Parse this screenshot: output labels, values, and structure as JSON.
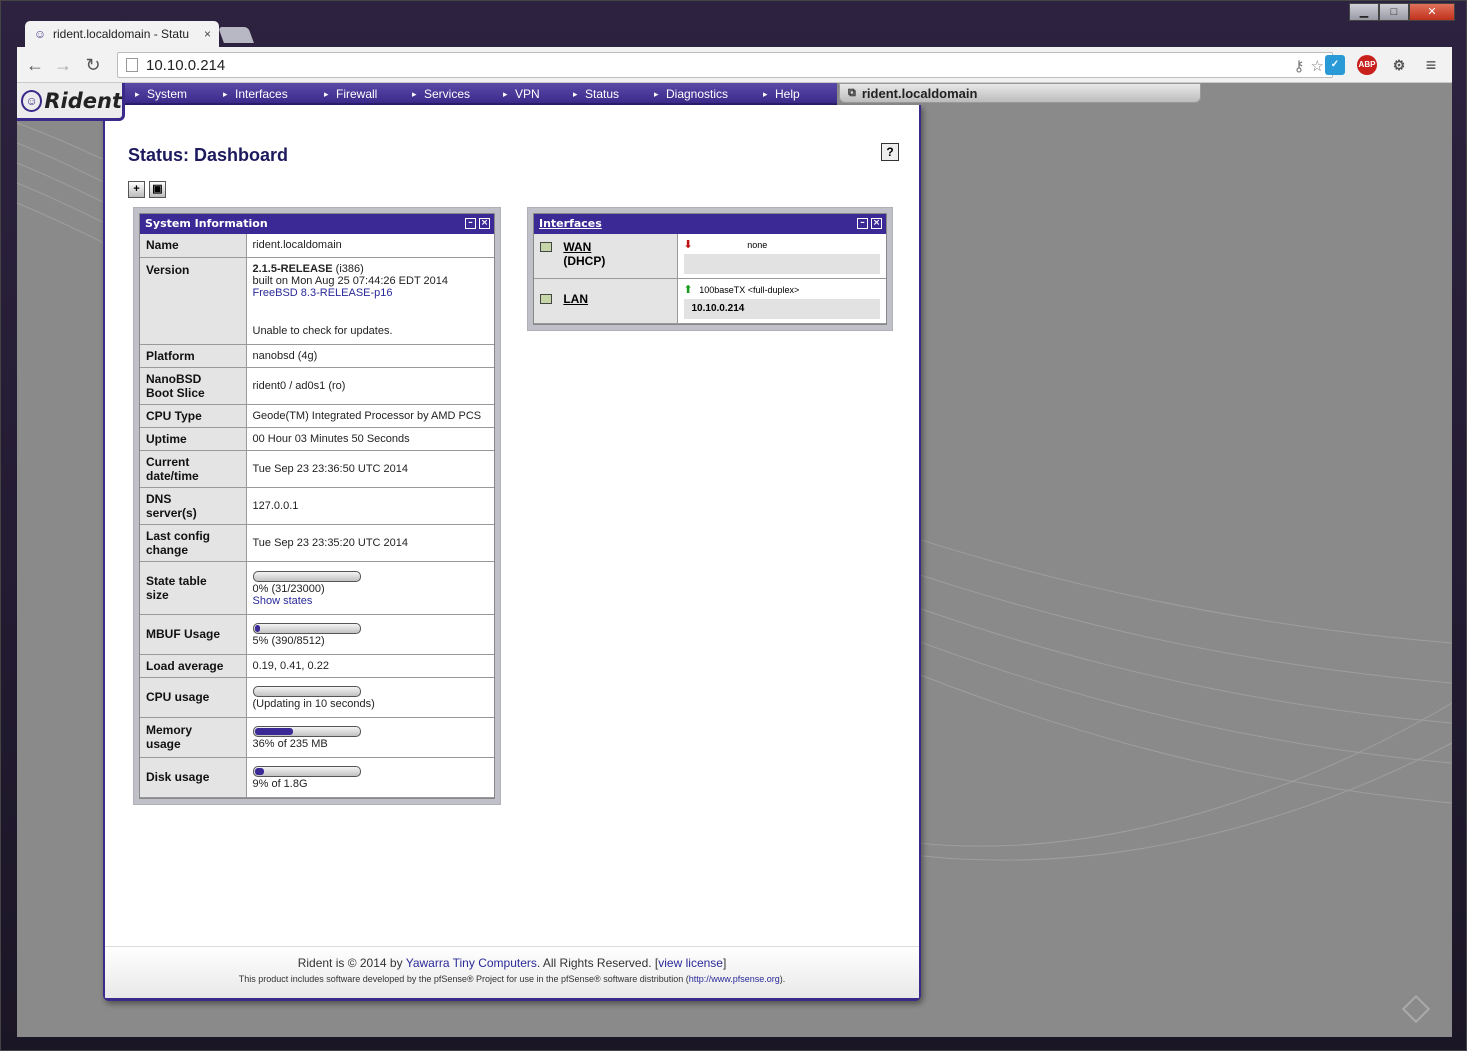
{
  "browser": {
    "tab_title": "rident.localdomain - Statu",
    "tab_close": "×",
    "url": "10.10.0.214",
    "back": "←",
    "forward": "→",
    "reload": "↻",
    "menu": "≡",
    "window_min": "▁",
    "window_max": "□",
    "window_close": "✕",
    "ext_abp": "ABP"
  },
  "nav": {
    "logo": "Rident",
    "items": [
      "System",
      "Interfaces",
      "Firewall",
      "Services",
      "VPN",
      "Status",
      "Diagnostics",
      "Help"
    ],
    "hostname": "rident.localdomain"
  },
  "page": {
    "title": "Status: Dashboard",
    "help": "?"
  },
  "system_info": {
    "title": "System Information",
    "name_label": "Name",
    "name": "rident.localdomain",
    "version_label": "Version",
    "version_release": "2.1.5-RELEASE",
    "version_arch": "(i386)",
    "version_built": "built on Mon Aug 25 07:44:26 EDT 2014",
    "version_freebsd": "FreeBSD 8.3-RELEASE-p16",
    "version_update": "Unable to check for updates.",
    "platform_label": "Platform",
    "platform": "nanobsd (4g)",
    "bootslice_label_1": "NanoBSD",
    "bootslice_label_2": "Boot Slice",
    "bootslice": "rident0 / ad0s1 (ro)",
    "cpu_type_label": "CPU Type",
    "cpu_type": "Geode(TM) Integrated Processor by AMD PCS",
    "uptime_label": "Uptime",
    "uptime": "00 Hour 03 Minutes 50 Seconds",
    "datetime_label_1": "Current",
    "datetime_label_2": "date/time",
    "datetime": "Tue Sep 23 23:36:50 UTC 2014",
    "dns_label_1": "DNS",
    "dns_label_2": "server(s)",
    "dns": "127.0.0.1",
    "lastconfig_label_1": "Last config",
    "lastconfig_label_2": "change",
    "lastconfig": "Tue Sep 23 23:35:20 UTC 2014",
    "state_label_1": "State table",
    "state_label_2": "size",
    "state_value": "0% (31/23000)",
    "state_fraction": 0.0,
    "show_states": "Show states",
    "mbuf_label": "MBUF Usage",
    "mbuf_value": "5% (390/8512)",
    "mbuf_fraction": 0.05,
    "load_label": "Load average",
    "load": "0.19, 0.41, 0.22",
    "cpu_label": "CPU usage",
    "cpu_value": "(Updating in 10 seconds)",
    "cpu_fraction": 0.0,
    "mem_label_1": "Memory",
    "mem_label_2": "usage",
    "mem_value": "36% of 235 MB",
    "mem_fraction": 0.36,
    "disk_label": "Disk usage",
    "disk_value": "9% of 1.8G",
    "disk_fraction": 0.09
  },
  "interfaces": {
    "title": "Interfaces",
    "wan_name": "WAN",
    "wan_type": "(DHCP)",
    "wan_arrow": "⬇",
    "wan_media": "none",
    "wan_ip": "",
    "lan_name": "LAN",
    "lan_arrow": "⬆",
    "lan_media": "100baseTX <full-duplex>",
    "lan_ip": "10.10.0.214"
  },
  "footer": {
    "line1_a": "Rident is © 2014 by ",
    "line1_b": "Yawarra Tiny Computers",
    "line1_c": ". All Rights Reserved. [",
    "line1_d": "view license",
    "line1_e": "]",
    "line2_a": "This product includes software developed by the pfSense® Project for use in the pfSense® software distribution (",
    "line2_b": "http://www.pfsense.org",
    "line2_c": ")."
  },
  "colors": {
    "accent": "#3b2a96",
    "nav": "#3b2a8a"
  }
}
